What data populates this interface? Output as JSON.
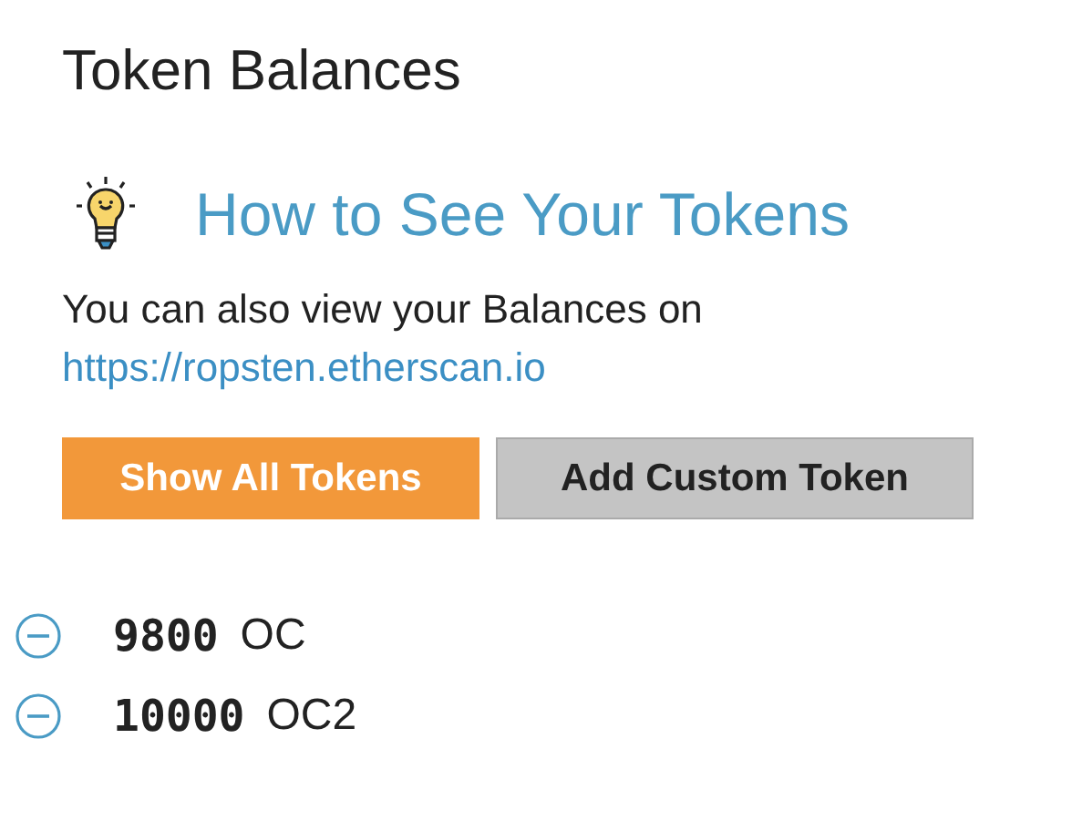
{
  "title": "Token Balances",
  "help": {
    "heading": "How to See Your Tokens",
    "text": "You can also view your Balances on",
    "link": "https://ropsten.etherscan.io"
  },
  "buttons": [
    {
      "label": "Show All Tokens",
      "kind": "primary"
    },
    {
      "label": "Add Custom Token",
      "kind": "secondary"
    }
  ],
  "tokens": [
    {
      "amount": "9800",
      "symbol": "OC"
    },
    {
      "amount": "10000",
      "symbol": "OC2"
    }
  ]
}
